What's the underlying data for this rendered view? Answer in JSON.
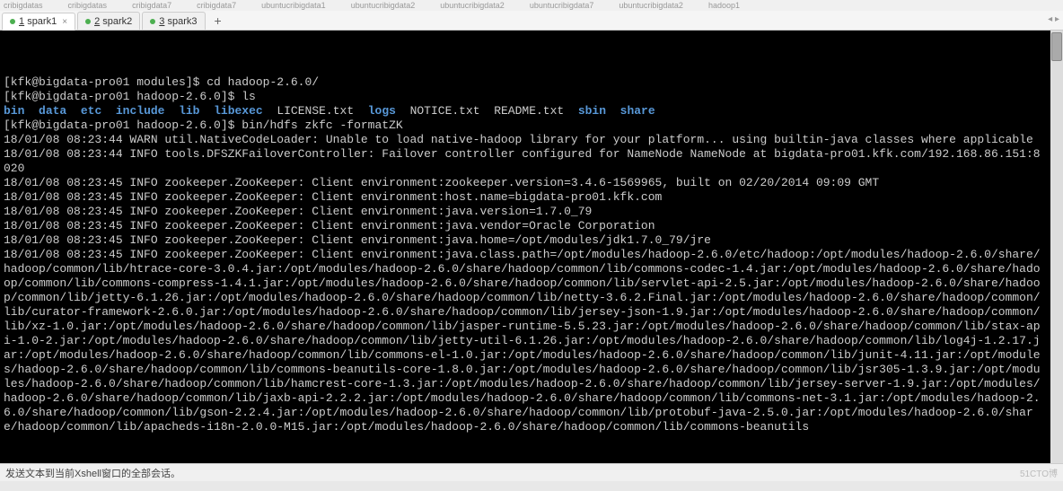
{
  "faded_tabs": [
    "cribigdatas",
    "cribigdatas",
    "cribigdata7",
    "cribigdata7",
    "ubuntucribigdata1",
    "ubuntucribigdata2",
    "ubuntucribigdata2",
    "ubuntucribigdata7",
    "ubuntucribigdata2",
    "hadoop1"
  ],
  "tabs": [
    {
      "num": "1",
      "label": "spark1",
      "active": true,
      "dot": "green"
    },
    {
      "num": "2",
      "label": "spark2",
      "active": false,
      "dot": "green"
    },
    {
      "num": "3",
      "label": "spark3",
      "active": false,
      "dot": "green"
    }
  ],
  "add_tab": "+",
  "right_arrow": "◂ ▸",
  "term": {
    "p1": "[kfk@bigdata-pro01 modules]$ ",
    "c1": "cd hadoop-2.6.0/",
    "p2": "[kfk@bigdata-pro01 hadoop-2.6.0]$ ",
    "c2": "ls",
    "ls_bin": "bin",
    "ls_data": "data",
    "ls_etc": "etc",
    "ls_include": "include",
    "ls_lib": "lib",
    "ls_libexec": "libexec",
    "ls_license": "LICENSE.txt",
    "ls_logs": "logs",
    "ls_notice": "NOTICE.txt",
    "ls_readme": "README.txt",
    "ls_sbin": "sbin",
    "ls_share": "share",
    "p3": "[kfk@bigdata-pro01 hadoop-2.6.0]$ ",
    "c3": "bin/hdfs zkfc -formatZK",
    "l1": "18/01/08 08:23:44 WARN util.NativeCodeLoader: Unable to load native-hadoop library for your platform... using builtin-java classes where applicable",
    "l2": "18/01/08 08:23:44 INFO tools.DFSZKFailoverController: Failover controller configured for NameNode NameNode at bigdata-pro01.kfk.com/192.168.86.151:8020",
    "l3": "18/01/08 08:23:45 INFO zookeeper.ZooKeeper: Client environment:zookeeper.version=3.4.6-1569965, built on 02/20/2014 09:09 GMT",
    "l4": "18/01/08 08:23:45 INFO zookeeper.ZooKeeper: Client environment:host.name=bigdata-pro01.kfk.com",
    "l5": "18/01/08 08:23:45 INFO zookeeper.ZooKeeper: Client environment:java.version=1.7.0_79",
    "l6": "18/01/08 08:23:45 INFO zookeeper.ZooKeeper: Client environment:java.vendor=Oracle Corporation",
    "l7": "18/01/08 08:23:45 INFO zookeeper.ZooKeeper: Client environment:java.home=/opt/modules/jdk1.7.0_79/jre",
    "l8": "18/01/08 08:23:45 INFO zookeeper.ZooKeeper: Client environment:java.class.path=/opt/modules/hadoop-2.6.0/etc/hadoop:/opt/modules/hadoop-2.6.0/share/hadoop/common/lib/htrace-core-3.0.4.jar:/opt/modules/hadoop-2.6.0/share/hadoop/common/lib/commons-codec-1.4.jar:/opt/modules/hadoop-2.6.0/share/hadoop/common/lib/commons-compress-1.4.1.jar:/opt/modules/hadoop-2.6.0/share/hadoop/common/lib/servlet-api-2.5.jar:/opt/modules/hadoop-2.6.0/share/hadoop/common/lib/jetty-6.1.26.jar:/opt/modules/hadoop-2.6.0/share/hadoop/common/lib/netty-3.6.2.Final.jar:/opt/modules/hadoop-2.6.0/share/hadoop/common/lib/curator-framework-2.6.0.jar:/opt/modules/hadoop-2.6.0/share/hadoop/common/lib/jersey-json-1.9.jar:/opt/modules/hadoop-2.6.0/share/hadoop/common/lib/xz-1.0.jar:/opt/modules/hadoop-2.6.0/share/hadoop/common/lib/jasper-runtime-5.5.23.jar:/opt/modules/hadoop-2.6.0/share/hadoop/common/lib/stax-api-1.0-2.jar:/opt/modules/hadoop-2.6.0/share/hadoop/common/lib/jetty-util-6.1.26.jar:/opt/modules/hadoop-2.6.0/share/hadoop/common/lib/log4j-1.2.17.jar:/opt/modules/hadoop-2.6.0/share/hadoop/common/lib/commons-el-1.0.jar:/opt/modules/hadoop-2.6.0/share/hadoop/common/lib/junit-4.11.jar:/opt/modules/hadoop-2.6.0/share/hadoop/common/lib/commons-beanutils-core-1.8.0.jar:/opt/modules/hadoop-2.6.0/share/hadoop/common/lib/jsr305-1.3.9.jar:/opt/modules/hadoop-2.6.0/share/hadoop/common/lib/hamcrest-core-1.3.jar:/opt/modules/hadoop-2.6.0/share/hadoop/common/lib/jersey-server-1.9.jar:/opt/modules/hadoop-2.6.0/share/hadoop/common/lib/jaxb-api-2.2.2.jar:/opt/modules/hadoop-2.6.0/share/hadoop/common/lib/commons-net-3.1.jar:/opt/modules/hadoop-2.6.0/share/hadoop/common/lib/gson-2.2.4.jar:/opt/modules/hadoop-2.6.0/share/hadoop/common/lib/protobuf-java-2.5.0.jar:/opt/modules/hadoop-2.6.0/share/hadoop/common/lib/apacheds-i18n-2.0.0-M15.jar:/opt/modules/hadoop-2.6.0/share/hadoop/common/lib/commons-beanutils"
  },
  "status_left": "发送文本到当前Xshell窗口的全部会话。",
  "watermark": "51CTO博"
}
